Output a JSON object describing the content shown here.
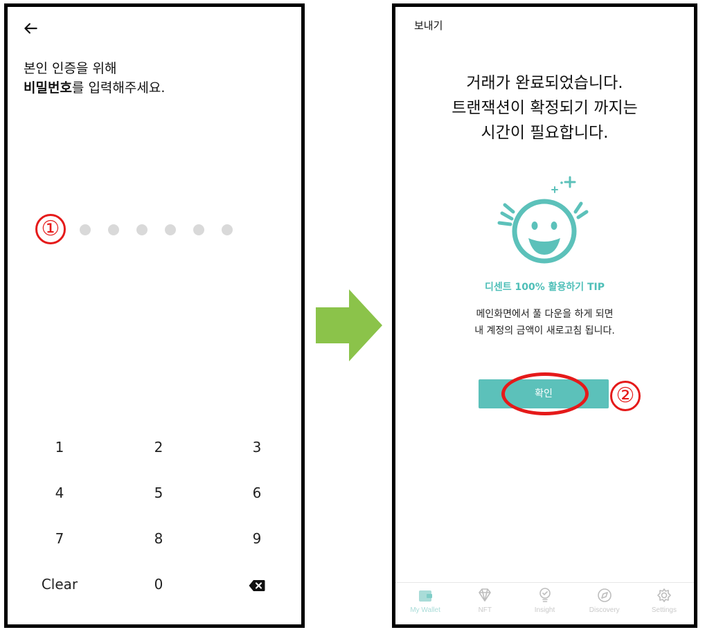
{
  "left_screen": {
    "prompt_line1": "본인 인증을 위해",
    "prompt_bold": "비밀번호",
    "prompt_rest": "를 입력해주세요.",
    "pin_length": 6,
    "step_marker": "①",
    "keypad": {
      "row1": [
        "1",
        "2",
        "3"
      ],
      "row2": [
        "4",
        "5",
        "6"
      ],
      "row3": [
        "7",
        "8",
        "9"
      ],
      "clear_label": "Clear",
      "zero_label": "0",
      "backspace_icon": "backspace-icon"
    }
  },
  "right_screen": {
    "title": "보내기",
    "message_line1": "거래가 완료되었습니다.",
    "message_line2": "트랜잭션이 확정되기 까지는",
    "message_line3": "시간이 필요합니다.",
    "tip_title": "디센트 100% 활용하기 TIP",
    "tip_line1": "메인화면에서 풀 다운을 하게 되면",
    "tip_line2": "내 계정의 금액이 새로고침 됩니다.",
    "confirm_label": "확인",
    "step_marker": "②",
    "nav": [
      {
        "label": "My Wallet",
        "icon": "wallet-icon",
        "active": true
      },
      {
        "label": "NFT",
        "icon": "diamond-icon",
        "active": false
      },
      {
        "label": "Insight",
        "icon": "lightbulb-icon",
        "active": false
      },
      {
        "label": "Discovery",
        "icon": "compass-icon",
        "active": false
      },
      {
        "label": "Settings",
        "icon": "gear-icon",
        "active": false
      }
    ]
  },
  "colors": {
    "accent": "#5cc1ba",
    "marker_red": "#e51a1a",
    "arrow_green": "#8bc34a",
    "pin_dot": "#d9d9d9"
  }
}
